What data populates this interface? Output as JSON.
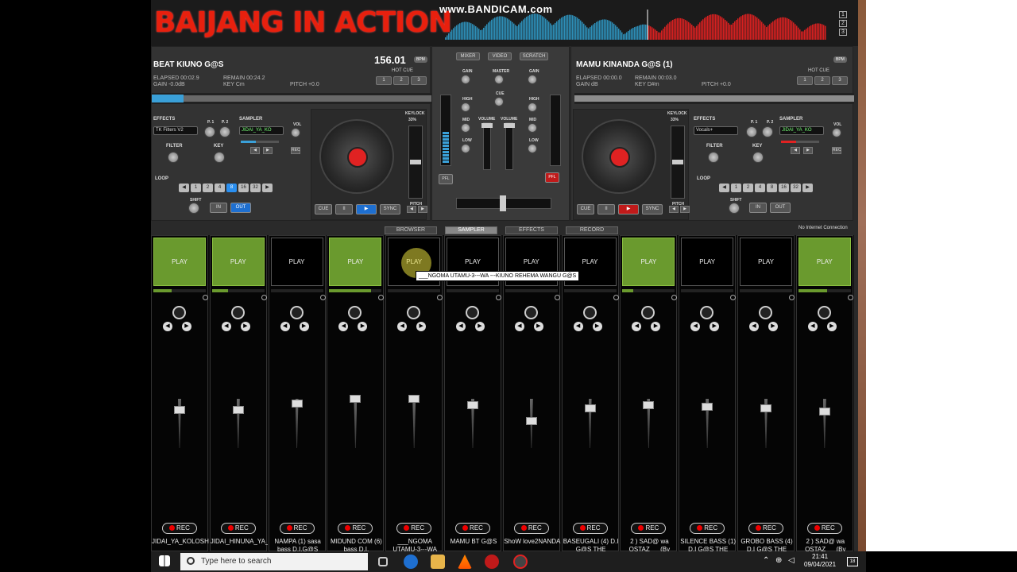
{
  "header": {
    "title": "BAIJANG IN ACTION",
    "watermark": "www.BANDICAM.com",
    "deck_buttons": [
      "1",
      "2",
      "3"
    ]
  },
  "deck_left": {
    "title": "BEAT KIUNO G@S",
    "bpm": "156.01",
    "bpm_tag": "BPM",
    "elapsed": "ELAPSED 00:02.9",
    "remain": "REMAIN 00:24.2",
    "gain": "GAIN -0.0dB",
    "key": "KEY Cm",
    "pitch": "PITCH +0.0",
    "hot_cue_label": "HOT CUE",
    "hot_cues": [
      "1",
      "2",
      "3"
    ],
    "effects_label": "EFFECTS",
    "effect_value": "TK Filters V2",
    "p1": "P. 1",
    "p2": "P. 2",
    "sampler_label": "SAMPLER",
    "sampler_value": "JIDAI_YA_KO",
    "vol": "VOL",
    "rec": "REC",
    "filter": "FILTER",
    "key_label": "KEY",
    "loop_label": "LOOP",
    "loops": [
      "1",
      "2",
      "4",
      "8",
      "16",
      "32"
    ],
    "shift": "SHIFT",
    "in": "IN",
    "out": "OUT",
    "keylock": "KEYLOCK",
    "keylock_pct": "33%",
    "cue": "CUE",
    "pause": "II",
    "sync": "SYNC",
    "pitch_label": "PITCH"
  },
  "deck_right": {
    "title": "MAMU KINANDA G@S (1)",
    "bpm_tag": "BPM",
    "elapsed": "ELAPSED 00:00.0",
    "remain": "REMAIN 00:03.0",
    "gain": "GAIN dB",
    "key": "KEY D#m",
    "pitch": "PITCH +0.0",
    "hot_cue_label": "HOT CUE",
    "hot_cues": [
      "1",
      "2",
      "3"
    ],
    "effects_label": "EFFECTS",
    "effect_value": "Vocals+",
    "p1": "P. 1",
    "p2": "P. 2",
    "sampler_label": "SAMPLER",
    "sampler_value": "JIDAI_YA_KO",
    "vol": "VOL",
    "rec": "REC",
    "filter": "FILTER",
    "key_label": "KEY",
    "loop_label": "LOOP",
    "loops": [
      "1",
      "2",
      "4",
      "8",
      "16",
      "32"
    ],
    "shift": "SHIFT",
    "in": "IN",
    "out": "OUT",
    "keylock": "KEYLOCK",
    "keylock_pct": "33%",
    "cue": "CUE",
    "pause": "II",
    "sync": "SYNC",
    "pitch_label": "PITCH"
  },
  "mixer": {
    "tabs": [
      "MIXER",
      "VIDEO",
      "SCRATCH"
    ],
    "gain": "GAIN",
    "master": "MASTER",
    "cue": "CUE",
    "high": "HIGH",
    "mid": "MID",
    "low": "LOW",
    "volume": "VOLUME",
    "pfl": "PFL"
  },
  "browser_tabs": [
    "BROWSER",
    "SAMPLER",
    "EFFECTS",
    "RECORD"
  ],
  "no_connection": "No Internet Connection",
  "sampler": {
    "play_label": "PLAY",
    "rec_label": "REC",
    "slots": [
      {
        "name": "JIDAI_YA_KOLOSHO_D...",
        "active": true,
        "level": 0.35
      },
      {
        "name": "JIDAI_HINUNA_YA_KGO",
        "active": true,
        "level": 0.3
      },
      {
        "name": "NAMPA (1) sasa bass D.I.G@S",
        "active": false,
        "level": 0
      },
      {
        "name": "MIDUND COM (6) bass D.I.",
        "active": true,
        "level": 0.8
      },
      {
        "name": "___NGOMA UTAMU-3---WA",
        "active": false,
        "level": 0
      },
      {
        "name": "MAMU BT G@S",
        "active": false,
        "level": 0
      },
      {
        "name": "ShoW love2NANDA",
        "active": false,
        "level": 0
      },
      {
        "name": "BASEUGALI (4) D.I G@S THE",
        "active": false,
        "level": 0
      },
      {
        "name": "2 ) SAD@ wa OSTAZ___(By",
        "active": true,
        "level": 0.2
      },
      {
        "name": "SILENCE BASS (1) D.I G@S THE",
        "active": false,
        "level": 0
      },
      {
        "name": "GROBO BASS (4) D.I G@S THE",
        "active": false,
        "level": 0
      },
      {
        "name": "2 ) SAD@ wa OSTAZ___(By",
        "active": true,
        "level": 0.55
      }
    ],
    "tooltip": "___NGOMA UTAMU-3---WA ---KIUNO REHEMA WANGU G@S"
  },
  "taskbar": {
    "search_placeholder": "Type here to search",
    "time": "21:41",
    "date": "09/04/2021",
    "notif": "18"
  },
  "colors": {
    "title_red": "#e8200e",
    "green": "#6a9a2e",
    "blue": "#1e6fd0",
    "red": "#c01a1a"
  }
}
